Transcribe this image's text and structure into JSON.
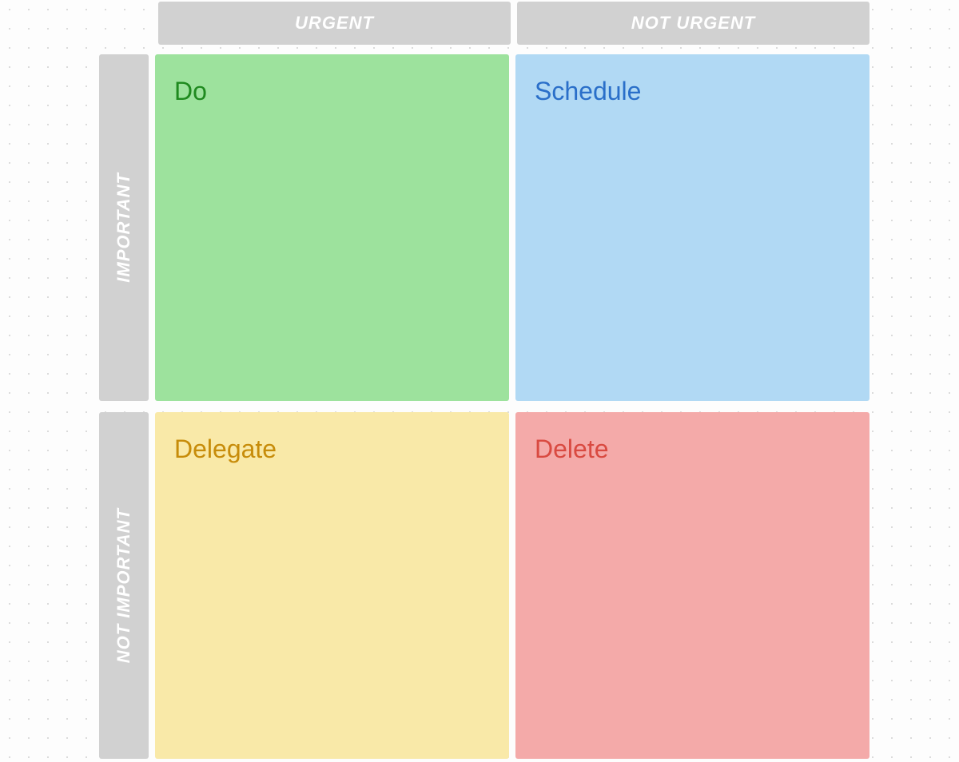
{
  "matrix": {
    "columns": {
      "urgent": "URGENT",
      "not_urgent": "NOT URGENT"
    },
    "rows": {
      "important": "IMPORTANT",
      "not_important": "NOT IMPORTANT"
    },
    "quadrants": {
      "do": {
        "title": "Do",
        "bg_color": "#9de29d",
        "text_color": "#1f8a1f"
      },
      "schedule": {
        "title": "Schedule",
        "bg_color": "#b1d9f4",
        "text_color": "#2a6fc9"
      },
      "delegate": {
        "title": "Delegate",
        "bg_color": "#f9e9a8",
        "text_color": "#c78c0a"
      },
      "delete": {
        "title": "Delete",
        "bg_color": "#f4aaa9",
        "text_color": "#d94a41"
      }
    }
  }
}
